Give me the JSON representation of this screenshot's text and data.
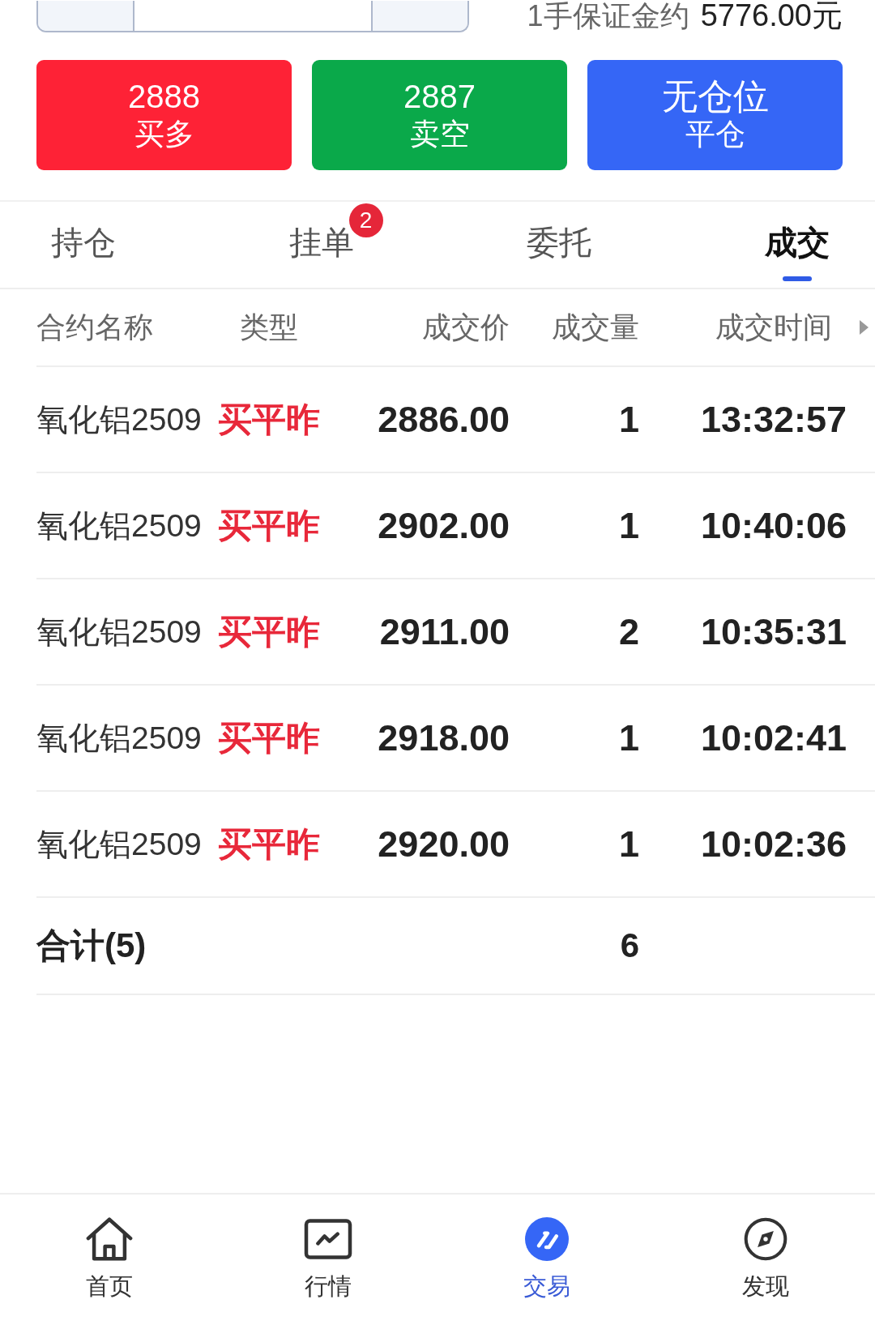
{
  "order_bar": {
    "margin_label": "1手保证金约",
    "margin_value": "5776.00元"
  },
  "actions": [
    {
      "kind": "buy",
      "title": "2888",
      "label": "买多"
    },
    {
      "kind": "sell",
      "title": "2887",
      "label": "卖空"
    },
    {
      "kind": "close",
      "title": "无仓位",
      "label": "平仓"
    }
  ],
  "tabs": [
    {
      "label": "持仓",
      "selected": false
    },
    {
      "label": "挂单",
      "selected": false,
      "badge": "2"
    },
    {
      "label": "委托",
      "selected": false
    },
    {
      "label": "成交",
      "selected": true
    }
  ],
  "table": {
    "columns": [
      "合约名称",
      "类型",
      "成交价",
      "成交量",
      "成交时间"
    ],
    "rows": [
      {
        "contract": "氧化铝2509",
        "type": "买平昨",
        "price": "2886.00",
        "volume": "1",
        "time": "13:32:57"
      },
      {
        "contract": "氧化铝2509",
        "type": "买平昨",
        "price": "2902.00",
        "volume": "1",
        "time": "10:40:06"
      },
      {
        "contract": "氧化铝2509",
        "type": "买平昨",
        "price": "2911.00",
        "volume": "2",
        "time": "10:35:31"
      },
      {
        "contract": "氧化铝2509",
        "type": "买平昨",
        "price": "2918.00",
        "volume": "1",
        "time": "10:02:41"
      },
      {
        "contract": "氧化铝2509",
        "type": "买平昨",
        "price": "2920.00",
        "volume": "1",
        "time": "10:02:36"
      }
    ],
    "total": {
      "label": "合计(5)",
      "volume": "6"
    }
  },
  "bottom_nav": [
    {
      "kind": "home",
      "label": "首页",
      "selected": false
    },
    {
      "kind": "market",
      "label": "行情",
      "selected": false
    },
    {
      "kind": "trade",
      "label": "交易",
      "selected": true
    },
    {
      "kind": "discover",
      "label": "发现",
      "selected": false
    }
  ]
}
